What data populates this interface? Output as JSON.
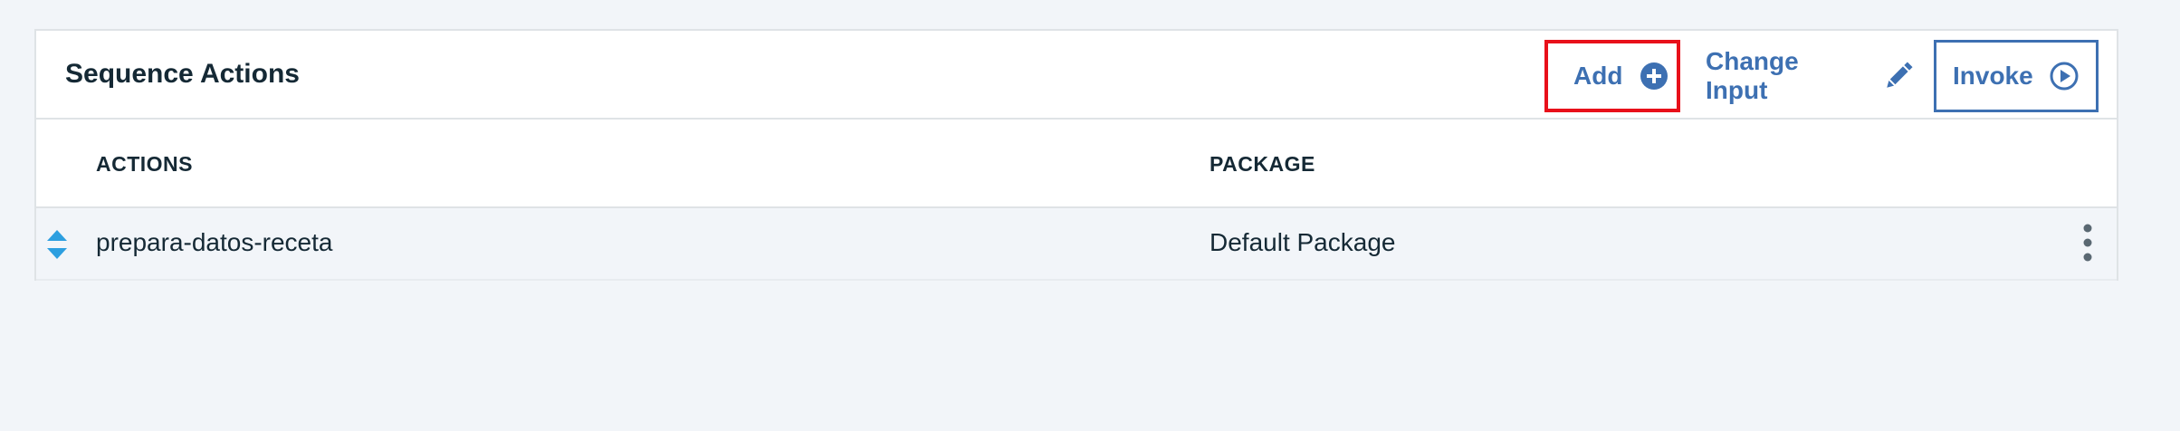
{
  "panel": {
    "title": "Sequence Actions"
  },
  "toolbar": {
    "add_label": "Add",
    "add_icon": "plus-circle-icon",
    "change_input_label": "Change Input",
    "change_input_icon": "pencil-icon",
    "invoke_label": "Invoke",
    "invoke_icon": "play-circle-icon"
  },
  "table": {
    "columns": [
      "ACTIONS",
      "PACKAGE"
    ],
    "rows": [
      {
        "action": "prepara-datos-receta",
        "package": "Default Package",
        "reorder_icon": "reorder-arrows-icon",
        "menu_icon": "overflow-menu-icon"
      }
    ]
  },
  "colors": {
    "accent": "#3d70b2",
    "highlight_border": "#e8101a",
    "reorder_icon": "#2d9fe0",
    "text": "#152935",
    "page_bg": "#f2f5f9"
  }
}
